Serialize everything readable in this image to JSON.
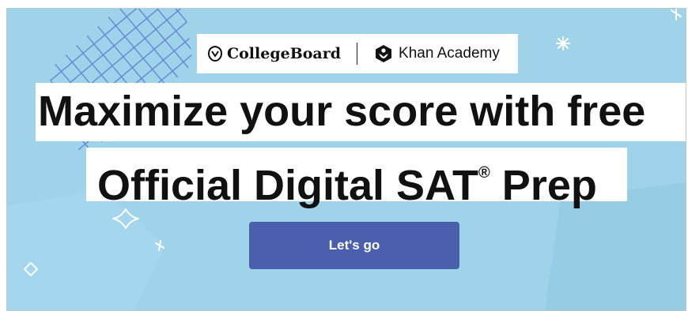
{
  "logos": {
    "college_board": "CollegeBoard",
    "khan_academy": "Khan Academy"
  },
  "headline": {
    "line1": "Maximize your score with free",
    "line2_prefix": "Official Digital SAT",
    "registered_mark": "®",
    "line2_suffix": " Prep"
  },
  "cta": {
    "label": "Let's go"
  },
  "colors": {
    "background": "#9fd3ea",
    "button": "#4a5fad",
    "grid_lines": "#4f6fd0"
  }
}
